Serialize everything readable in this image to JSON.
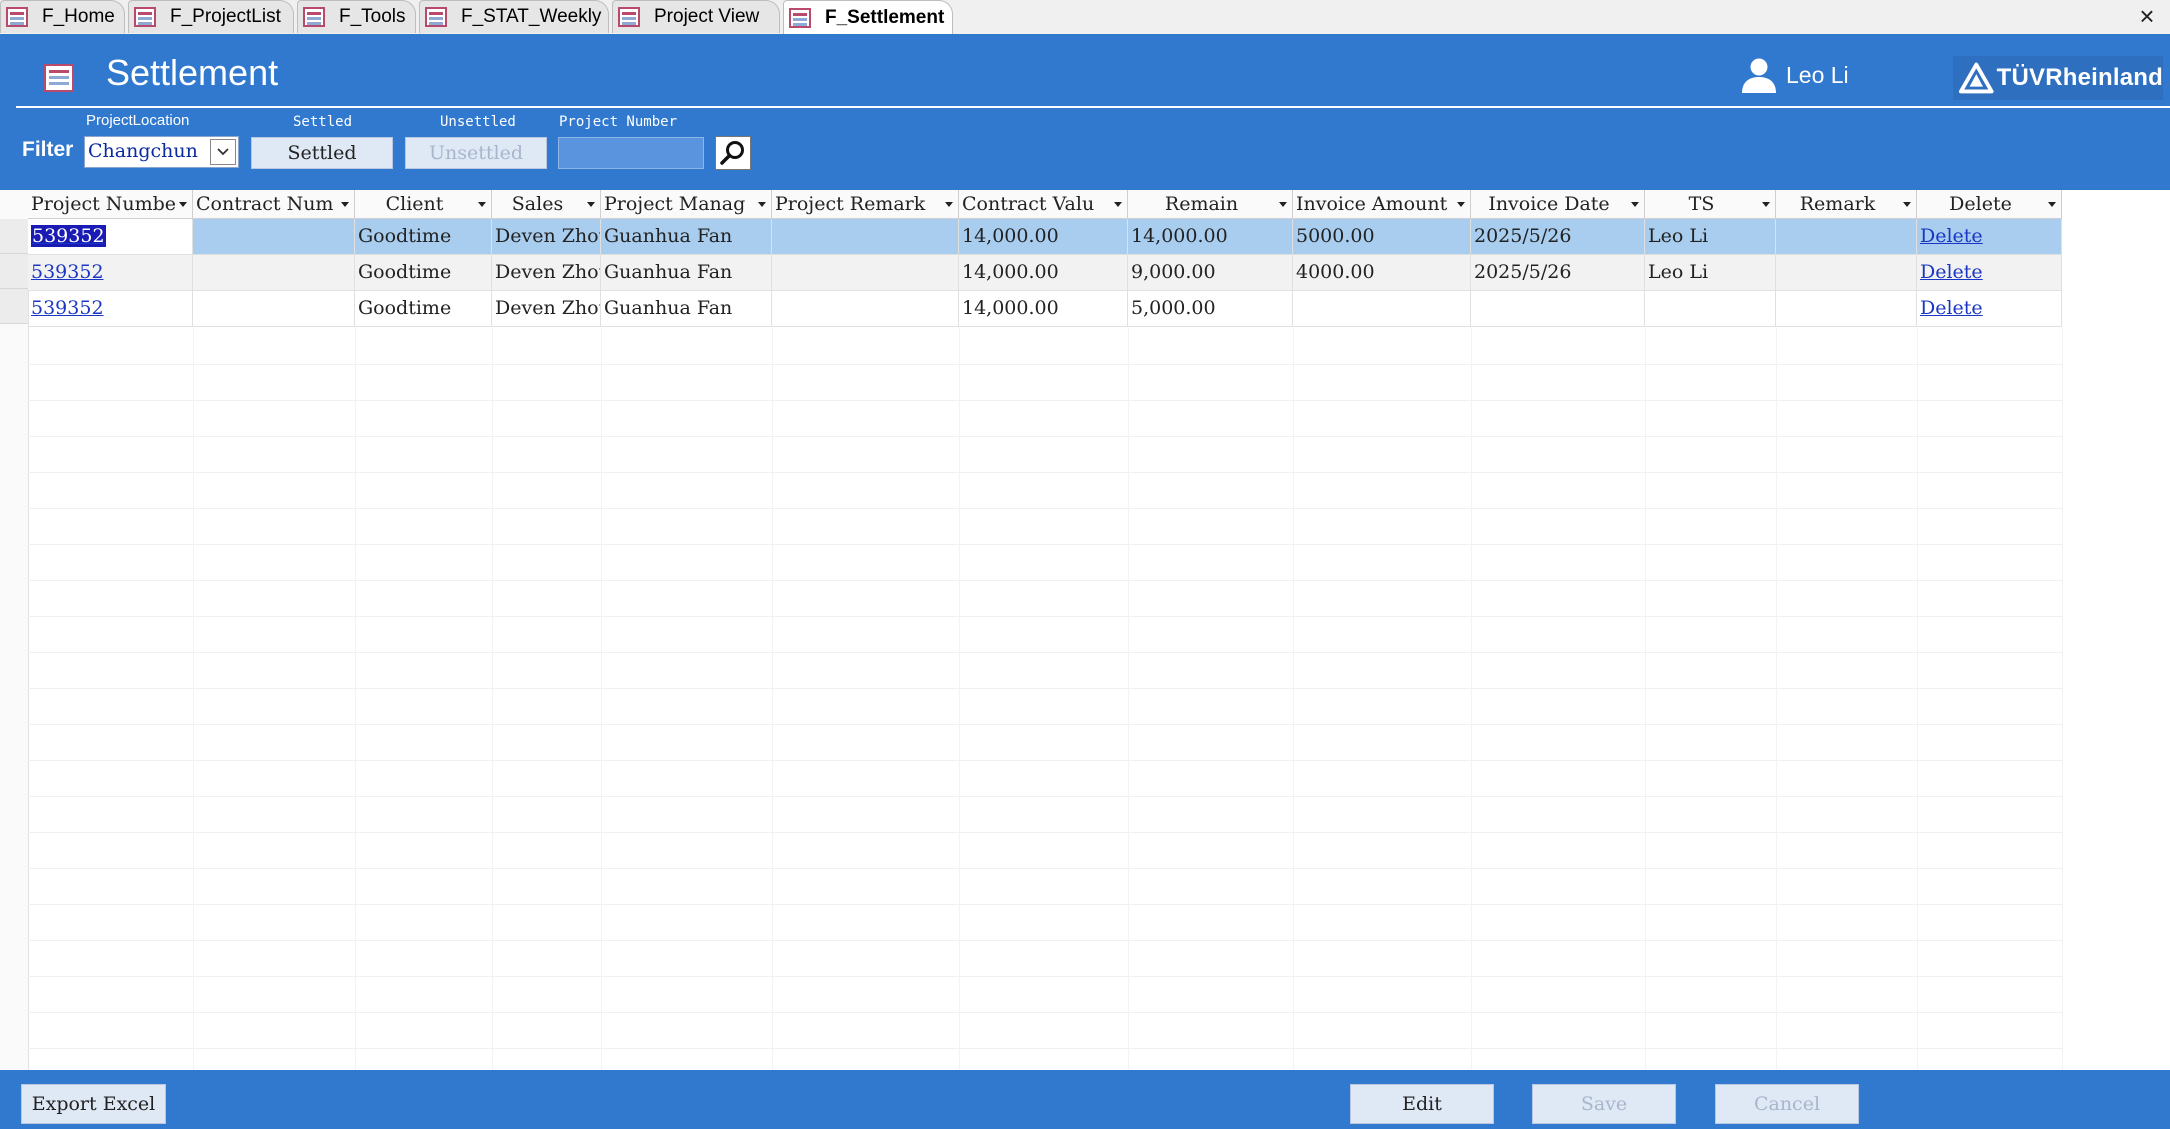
{
  "tabs": [
    {
      "label": "F_Home",
      "active": false
    },
    {
      "label": "F_ProjectList",
      "active": false
    },
    {
      "label": "F_Tools",
      "active": false
    },
    {
      "label": "F_STAT_Weekly",
      "active": false
    },
    {
      "label": "Project View",
      "active": false
    },
    {
      "label": "F_Settlement",
      "active": true
    }
  ],
  "tab_close": "×",
  "header": {
    "title": "Settlement",
    "user_name": "Leo Li",
    "logo_text": "TÜVRheinland"
  },
  "filter": {
    "label": "Filter",
    "location_label": "ProjectLocation",
    "location_value": "Changchun",
    "settled_label": "Settled",
    "settled_button": "Settled",
    "unsettled_label": "Unsettled",
    "unsettled_button": "Unsettled",
    "project_number_label": "Project Number",
    "project_number_value": ""
  },
  "columns": [
    "Project Numbe",
    "Contract Num",
    "Client",
    "Sales",
    "Project Manag",
    "Project Remark",
    "Contract Valu",
    "Remain",
    "Invoice Amount",
    "Invoice Date",
    "TS",
    "Remark",
    "Delete"
  ],
  "rows": [
    [
      "539352",
      "",
      "Goodtime",
      "Deven Zhou",
      "Guanhua Fan",
      "",
      "14,000.00",
      "14,000.00",
      "5000.00",
      "2025/5/26",
      "Leo Li",
      "",
      "Delete"
    ],
    [
      "539352",
      "",
      "Goodtime",
      "Deven Zhou",
      "Guanhua Fan",
      "",
      "14,000.00",
      "9,000.00",
      "4000.00",
      "2025/5/26",
      "Leo Li",
      "",
      "Delete"
    ],
    [
      "539352",
      "",
      "Goodtime",
      "Deven Zhou",
      "Guanhua Fan",
      "",
      "14,000.00",
      "5,000.00",
      "",
      "",
      "",
      "",
      "Delete"
    ]
  ],
  "footer": {
    "export_button": "Export Excel",
    "edit_button": "Edit",
    "save_button": "Save",
    "cancel_button": "Cancel"
  },
  "colors": {
    "header_blue": "#3079cf",
    "selected_row": "#a8cdef",
    "link": "#1a36c4"
  }
}
